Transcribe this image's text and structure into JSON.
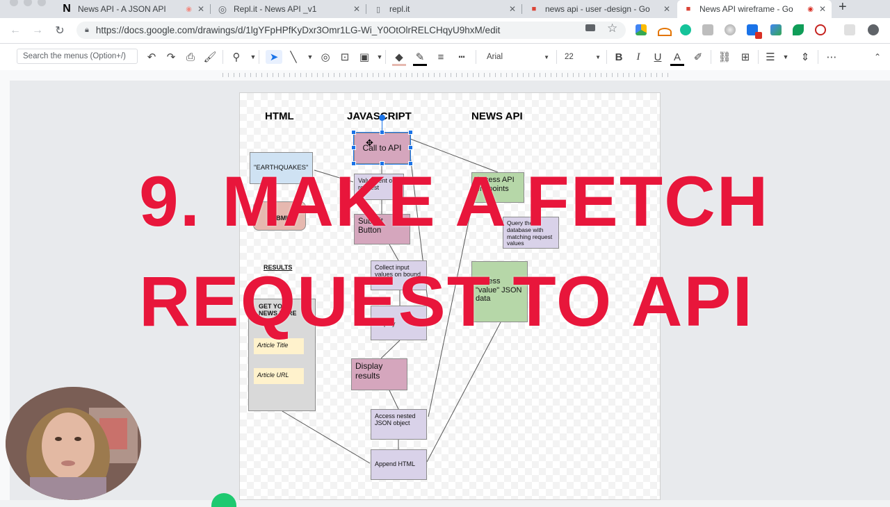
{
  "browser": {
    "tabs": [
      {
        "title": "News API - A JSON API",
        "icon": "notion-icon",
        "icon_glyph": "N",
        "active": false
      },
      {
        "title": "Repl.it - News API _v1",
        "icon": "replit-icon",
        "icon_glyph": "◎",
        "active": false
      },
      {
        "title": "repl.it",
        "icon": "document-icon",
        "icon_glyph": "▯",
        "active": false
      },
      {
        "title": "news api - user -design - Go",
        "icon": "drawings-icon",
        "icon_glyph": "■",
        "active": false
      },
      {
        "title": "News API wireframe - Go",
        "icon": "drawings-icon",
        "icon_glyph": "■",
        "active": true
      }
    ],
    "new_tab_glyph": "+",
    "url": "https://docs.google.com/drawings/d/1lgYFpHPfKyDxr3Omr1LG-Wi_Y0OtOlrRELCHqyU9hxM/edit"
  },
  "toolbar": {
    "search_placeholder": "Search the menus (Option+/)",
    "font_name": "Arial",
    "font_size": "22",
    "bold": "B",
    "italic": "I",
    "underline": "U",
    "text_color": "A",
    "more": "⋯"
  },
  "diagram": {
    "headers": {
      "html": "HTML",
      "javascript": "JAVASCRIPT",
      "news_api": "NEWS API"
    },
    "html_column": {
      "search_box": "\"EARTHQUAKES\"",
      "submit_button": "SUBMIT",
      "results_label": "RESULTS",
      "results_heading": "GET YOUR NEWS HERE",
      "article_title": "Article Title",
      "article_url": "Article URL"
    },
    "js_column": {
      "call_api": "Call to API",
      "value_request": "Value sent on request",
      "submit_button": "Submit Button",
      "collect_input": "Collect input values on bound value",
      "display": "Display",
      "display_results": "Display results",
      "access_nested": "Access nested JSON object",
      "append_html": "Append HTML"
    },
    "api_column": {
      "access_endpoints": "Access API endpoints",
      "query_database": "Query the database with matching request values",
      "access_value": "Access \"value\" JSON data"
    }
  },
  "overlay": {
    "line1": "9. MAKE A FETCH",
    "line2": "REQUEST TO API"
  },
  "colors": {
    "overlay_text": "#e8163b",
    "pink_box": "#d5a6bd",
    "lavender_box": "#d9d2e9",
    "green_box": "#b6d7a8",
    "blue_box": "#cfe2f3",
    "selection": "#1a73e8"
  }
}
